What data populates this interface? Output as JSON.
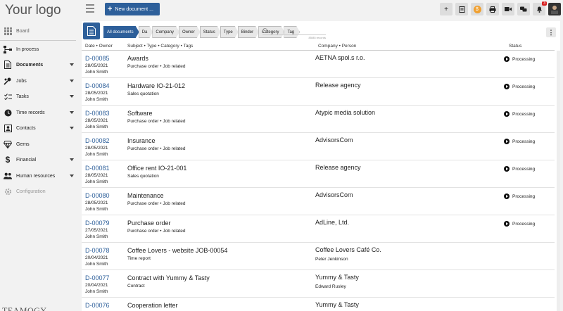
{
  "app": {
    "logo_text": "Your logo",
    "new_document_label": "New document ...",
    "notifications_badge": "3",
    "footer_logo_text": "TEAMOGY"
  },
  "top_icons": [
    "add-icon",
    "notes-icon",
    "coin-icon",
    "print-icon",
    "video-icon",
    "chat-icon",
    "bell-icon",
    "avatar-icon"
  ],
  "sidebar": {
    "items": [
      {
        "label": "Board",
        "icon": "grid-icon"
      },
      {
        "label": "In process",
        "icon": "process-icon"
      },
      {
        "label": "Documents",
        "icon": "document-icon"
      },
      {
        "label": "Jobs",
        "icon": "jobs-icon"
      },
      {
        "label": "Tasks",
        "icon": "tasks-icon"
      },
      {
        "label": "Time records",
        "icon": "clock-icon"
      },
      {
        "label": "Contacts",
        "icon": "contacts-icon"
      },
      {
        "label": "Gems",
        "icon": "gem-icon"
      },
      {
        "label": "Financial",
        "icon": "dollar-icon"
      },
      {
        "label": "Human resources",
        "icon": "people-icon"
      },
      {
        "label": "Configuration",
        "icon": "gear-icon"
      }
    ]
  },
  "filters": {
    "chips": [
      "All documents",
      "Da",
      "Company",
      "Owner",
      "Status",
      "Type",
      "Binder",
      "Category",
      "Tag"
    ],
    "search_placeholder": "",
    "count": "85/85 records"
  },
  "table": {
    "headers": {
      "date_owner": "Date • Owner",
      "subject": "Subject • Type • Category • Tags",
      "company": "Company • Person",
      "status": "Status"
    },
    "rows": [
      {
        "id": "D-00085",
        "date": "28/05/2021",
        "owner": "John Smith",
        "subject": "Awards",
        "type": "Purchase order • Job related",
        "company": "AETNA spol.s r.o.",
        "person": "",
        "status": "Processing"
      },
      {
        "id": "D-00084",
        "date": "28/05/2021",
        "owner": "John Smith",
        "subject": "Hardware IO-21-012",
        "type": "Sales quotation",
        "company": "Release agency",
        "person": "",
        "status": "Processing"
      },
      {
        "id": "D-00083",
        "date": "28/05/2021",
        "owner": "John Smith",
        "subject": "Software",
        "type": "Purchase order • Job related",
        "company": "Atypic media solution",
        "person": "",
        "status": "Processing"
      },
      {
        "id": "D-00082",
        "date": "28/05/2021",
        "owner": "John Smith",
        "subject": "Insurance",
        "type": "Purchase order • Job related",
        "company": "AdvisorsCom",
        "person": "",
        "status": "Processing"
      },
      {
        "id": "D-00081",
        "date": "28/05/2021",
        "owner": "John Smith",
        "subject": "Office rent IO-21-001",
        "type": "Sales quotation",
        "company": "Release agency",
        "person": "",
        "status": "Processing"
      },
      {
        "id": "D-00080",
        "date": "28/05/2021",
        "owner": "John Smith",
        "subject": "Maintenance",
        "type": "Purchase order • Job related",
        "company": "AdvisorsCom",
        "person": "",
        "status": "Processing"
      },
      {
        "id": "D-00079",
        "date": "27/05/2021",
        "owner": "John Smith",
        "subject": "Purchase order",
        "type": "Purchase order • Job related",
        "company": "AdLine, Ltd.",
        "person": "",
        "status": "Processing"
      },
      {
        "id": "D-00078",
        "date": "20/04/2021",
        "owner": "John Smith",
        "subject": "Coffee Lovers - website JOB-00054",
        "type": "Time report",
        "company": "Coffee Lovers Café Co.",
        "person": "Peter Jenkinson",
        "status": ""
      },
      {
        "id": "D-00077",
        "date": "20/04/2021",
        "owner": "John Smith",
        "subject": "Contract with Yummy & Tasty",
        "type": "Contract",
        "company": "Yummy & Tasty",
        "person": "Edward Rusley",
        "status": ""
      },
      {
        "id": "D-00076",
        "date": "",
        "owner": "",
        "subject": "Cooperation letter",
        "type": "",
        "company": "Yummy & Tasty",
        "person": "",
        "status": ""
      }
    ]
  }
}
